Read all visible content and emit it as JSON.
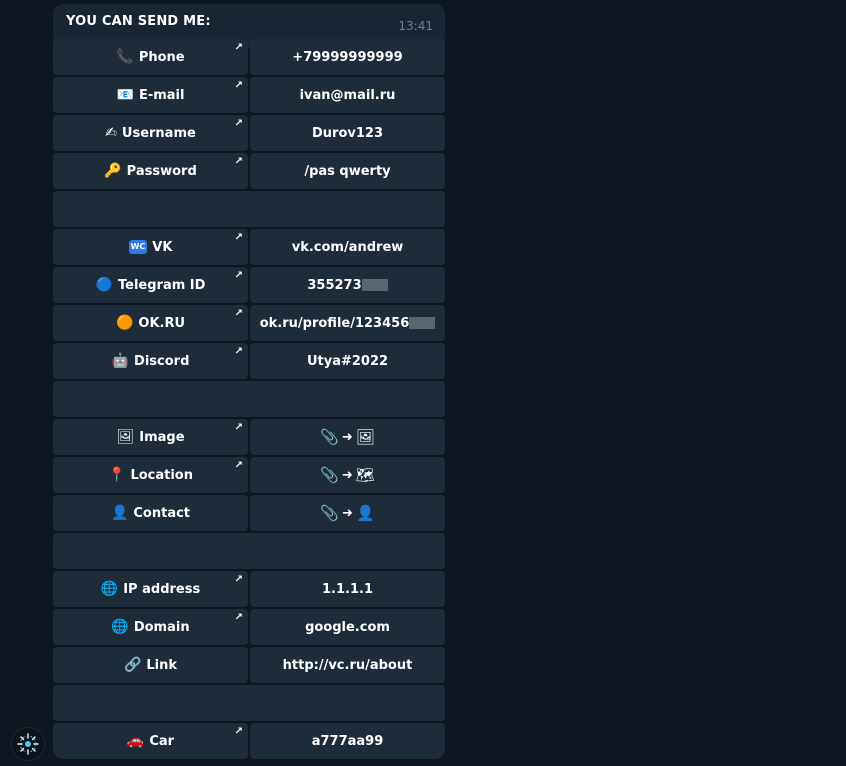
{
  "message": {
    "text": "YOU CAN SEND ME:",
    "time": "13:41"
  },
  "keyboard": {
    "rows": [
      {
        "type": "pair",
        "left": {
          "icon": "📞",
          "icon_name": "phone-icon",
          "label": "Phone"
        },
        "right": {
          "text": "+79999999999"
        }
      },
      {
        "type": "pair",
        "left": {
          "icon": "📧",
          "icon_name": "email-icon",
          "label": "E-mail"
        },
        "right": {
          "text": "ivan@mail.ru"
        }
      },
      {
        "type": "pair",
        "left": {
          "icon": "✍",
          "icon_name": "writing-hand-icon",
          "label": "Username"
        },
        "right": {
          "text": "Durov123"
        }
      },
      {
        "type": "pair",
        "left": {
          "icon": "🔑",
          "icon_name": "key-icon",
          "label": "Password"
        },
        "right": {
          "text": "/pas qwerty"
        }
      },
      {
        "type": "blank"
      },
      {
        "type": "pair",
        "left": {
          "icon": "WC",
          "icon_name": "vk-icon",
          "label": "VK"
        },
        "right": {
          "text": "vk.com/andrew"
        }
      },
      {
        "type": "pair",
        "left": {
          "icon": "🔵",
          "icon_name": "blue-circle-icon",
          "label": "Telegram ID"
        },
        "right": {
          "text": "355273",
          "redacted": true
        }
      },
      {
        "type": "pair",
        "left": {
          "icon": "🟠",
          "icon_name": "orange-circle-icon",
          "label": "OK.RU"
        },
        "right": {
          "text": "ok.ru/profile/123456",
          "redacted": true
        }
      },
      {
        "type": "pair",
        "left": {
          "icon": "🤖",
          "icon_name": "robot-icon",
          "label": "Discord"
        },
        "right": {
          "text": "Utya#2022"
        }
      },
      {
        "type": "blank"
      },
      {
        "type": "pair",
        "left": {
          "icon": "🖼",
          "icon_name": "image-icon",
          "label": "Image"
        },
        "right": {
          "from": "📎",
          "arrow": "➜",
          "to": "🖼"
        }
      },
      {
        "type": "pair",
        "left": {
          "icon": "📍",
          "icon_name": "pin-icon",
          "label": "Location"
        },
        "right": {
          "from": "📎",
          "arrow": "➜",
          "to": "🗺"
        }
      },
      {
        "type": "pair",
        "left": {
          "icon": "👤",
          "icon_name": "person-icon",
          "label": "Contact"
        },
        "right": {
          "from": "📎",
          "arrow": "➜",
          "to": "👤"
        }
      },
      {
        "type": "blank"
      },
      {
        "type": "pair",
        "left": {
          "icon": "🌐",
          "icon_name": "globe-icon",
          "label": "IP address"
        },
        "right": {
          "text": "1.1.1.1"
        }
      },
      {
        "type": "pair",
        "left": {
          "icon": "🌐",
          "icon_name": "globe-icon",
          "label": "Domain"
        },
        "right": {
          "text": "google.com"
        }
      },
      {
        "type": "pair",
        "left": {
          "icon": "🔗",
          "icon_name": "link-icon",
          "label": "Link"
        },
        "right": {
          "text": "http://vc.ru/about"
        }
      },
      {
        "type": "blank"
      },
      {
        "type": "pair",
        "left": {
          "icon": "🚗",
          "icon_name": "car-icon",
          "label": "Car"
        },
        "right": {
          "text": "a777aa99"
        }
      }
    ],
    "arrow_rows": [
      0,
      1,
      2,
      3,
      5,
      6,
      7,
      8,
      10,
      11,
      14,
      15,
      18
    ],
    "arrow_glyph": "↗"
  },
  "bot_avatar": {
    "icon_name": "bot-logo-icon"
  },
  "colors": {
    "background": "#0e1621",
    "bubble": "#182533",
    "key": "#1e2c3a",
    "time": "#6d7f8f"
  }
}
